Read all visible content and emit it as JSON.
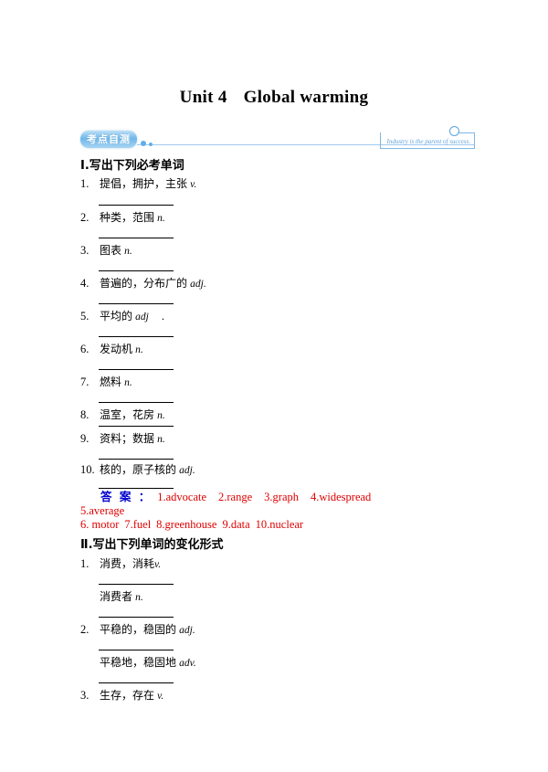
{
  "document": {
    "title_unit": "Unit 4",
    "title_topic": "Global warming"
  },
  "banner": {
    "badge_label": "考点自测",
    "motto": "Industry is the parent of success."
  },
  "sections": [
    {
      "heading": "Ⅰ.写出下列必考单词",
      "items": [
        {
          "num": "1.",
          "cn": "提倡，拥护，主张",
          "pos": "v."
        },
        {
          "num": "2.",
          "cn": "种类，范围",
          "pos": "n."
        },
        {
          "num": "3.",
          "cn": "图表",
          "pos": "n."
        },
        {
          "num": "4.",
          "cn": "普遍的，分布广的",
          "pos": "adj."
        },
        {
          "num": "5.",
          "cn": "平均的",
          "pos": "adj",
          "trailing": "."
        },
        {
          "num": "6.",
          "cn": "发动机",
          "pos": "n."
        },
        {
          "num": "7.",
          "cn": "燃料",
          "pos": "n."
        },
        {
          "num": "8.",
          "cn": "温室，花房",
          "pos": "n."
        },
        {
          "num": "9.",
          "cn": "资料；数据",
          "pos": "n."
        },
        {
          "num": "10.",
          "cn": "核的，原子核的",
          "pos": "adj."
        }
      ]
    },
    {
      "heading": "Ⅱ.写出下列单词的变化形式",
      "items": [
        {
          "num": "1.",
          "cn": "消费，消耗",
          "pos": "v.",
          "sub_cn": "消费者",
          "sub_pos": "n."
        },
        {
          "num": "2.",
          "cn": "平稳的，稳固的",
          "pos": "adj.",
          "sub_cn": "平稳地，稳固地",
          "sub_pos": "adv."
        },
        {
          "num": "3.",
          "cn": "生存，存在",
          "pos": "v."
        }
      ]
    }
  ],
  "answers": {
    "label": "答 案 ：",
    "line1": "1.advocate",
    "line1b": "2.range",
    "line1c": "3.graph",
    "line1d": "4.widespread",
    "line2": "5.average",
    "line3a": "6. motor",
    "line3b": "7.fuel",
    "line3c": "8.greenhouse",
    "line3d": "9.data",
    "line3e": "10.nuclear"
  },
  "colors": {
    "answer_label": "#0000cc",
    "answer_text": "#e00000",
    "banner_blue": "#7db9e6"
  }
}
